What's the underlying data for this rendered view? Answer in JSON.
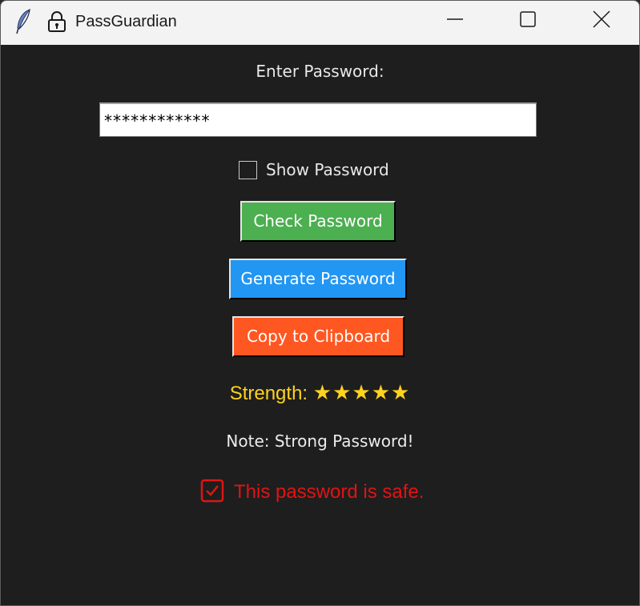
{
  "window": {
    "title": "PassGuardian",
    "icons": {
      "app": "feather-icon",
      "logo": "padlock-icon"
    },
    "controls": [
      "minimize-icon",
      "maximize-icon",
      "close-icon"
    ]
  },
  "form": {
    "prompt": "Enter Password:",
    "password_value": "************",
    "show_password_label": "Show Password",
    "show_password_checked": false
  },
  "buttons": {
    "check": "Check Password",
    "generate": "Generate Password",
    "copy": "Copy to Clipboard"
  },
  "result": {
    "strength_label": "Strength:",
    "strength_stars": "★★★★★",
    "strength_rating": 5,
    "strength_max": 5,
    "note": "Note: Strong Password!",
    "safe_text": "This password is safe.",
    "safe_icon": "checkbox-checked-icon"
  },
  "colors": {
    "background": "#1e1e1e",
    "check_button": "#4caf50",
    "generate_button": "#2196f3",
    "copy_button": "#ff5722",
    "strength": "#ffd21f",
    "safe": "#e01414"
  }
}
